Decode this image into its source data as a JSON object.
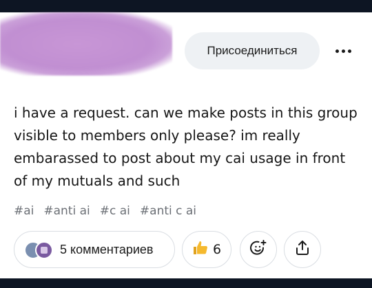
{
  "header": {
    "join_label": "Присоединиться",
    "more_icon": "more-horizontal-icon"
  },
  "post": {
    "text": "i have a request. can we make posts in this group visible to members only please? im really embarassed to post about my cai usage in front of my mutuals and such",
    "hashtags": [
      "#ai",
      "#anti ai",
      "#c ai",
      "#anti c ai"
    ]
  },
  "actions": {
    "comments_label": "5 комментариев",
    "like_count": "6",
    "like_icon": "thumbs-up-icon",
    "emoji_icon": "add-reaction-icon",
    "share_icon": "share-icon"
  },
  "colors": {
    "bar": "#0d1523",
    "redaction": "#c18fd2",
    "pill_bg": "#eef1f4",
    "hashtag": "#6b6f75",
    "like_yellow": "#f5b92e"
  }
}
